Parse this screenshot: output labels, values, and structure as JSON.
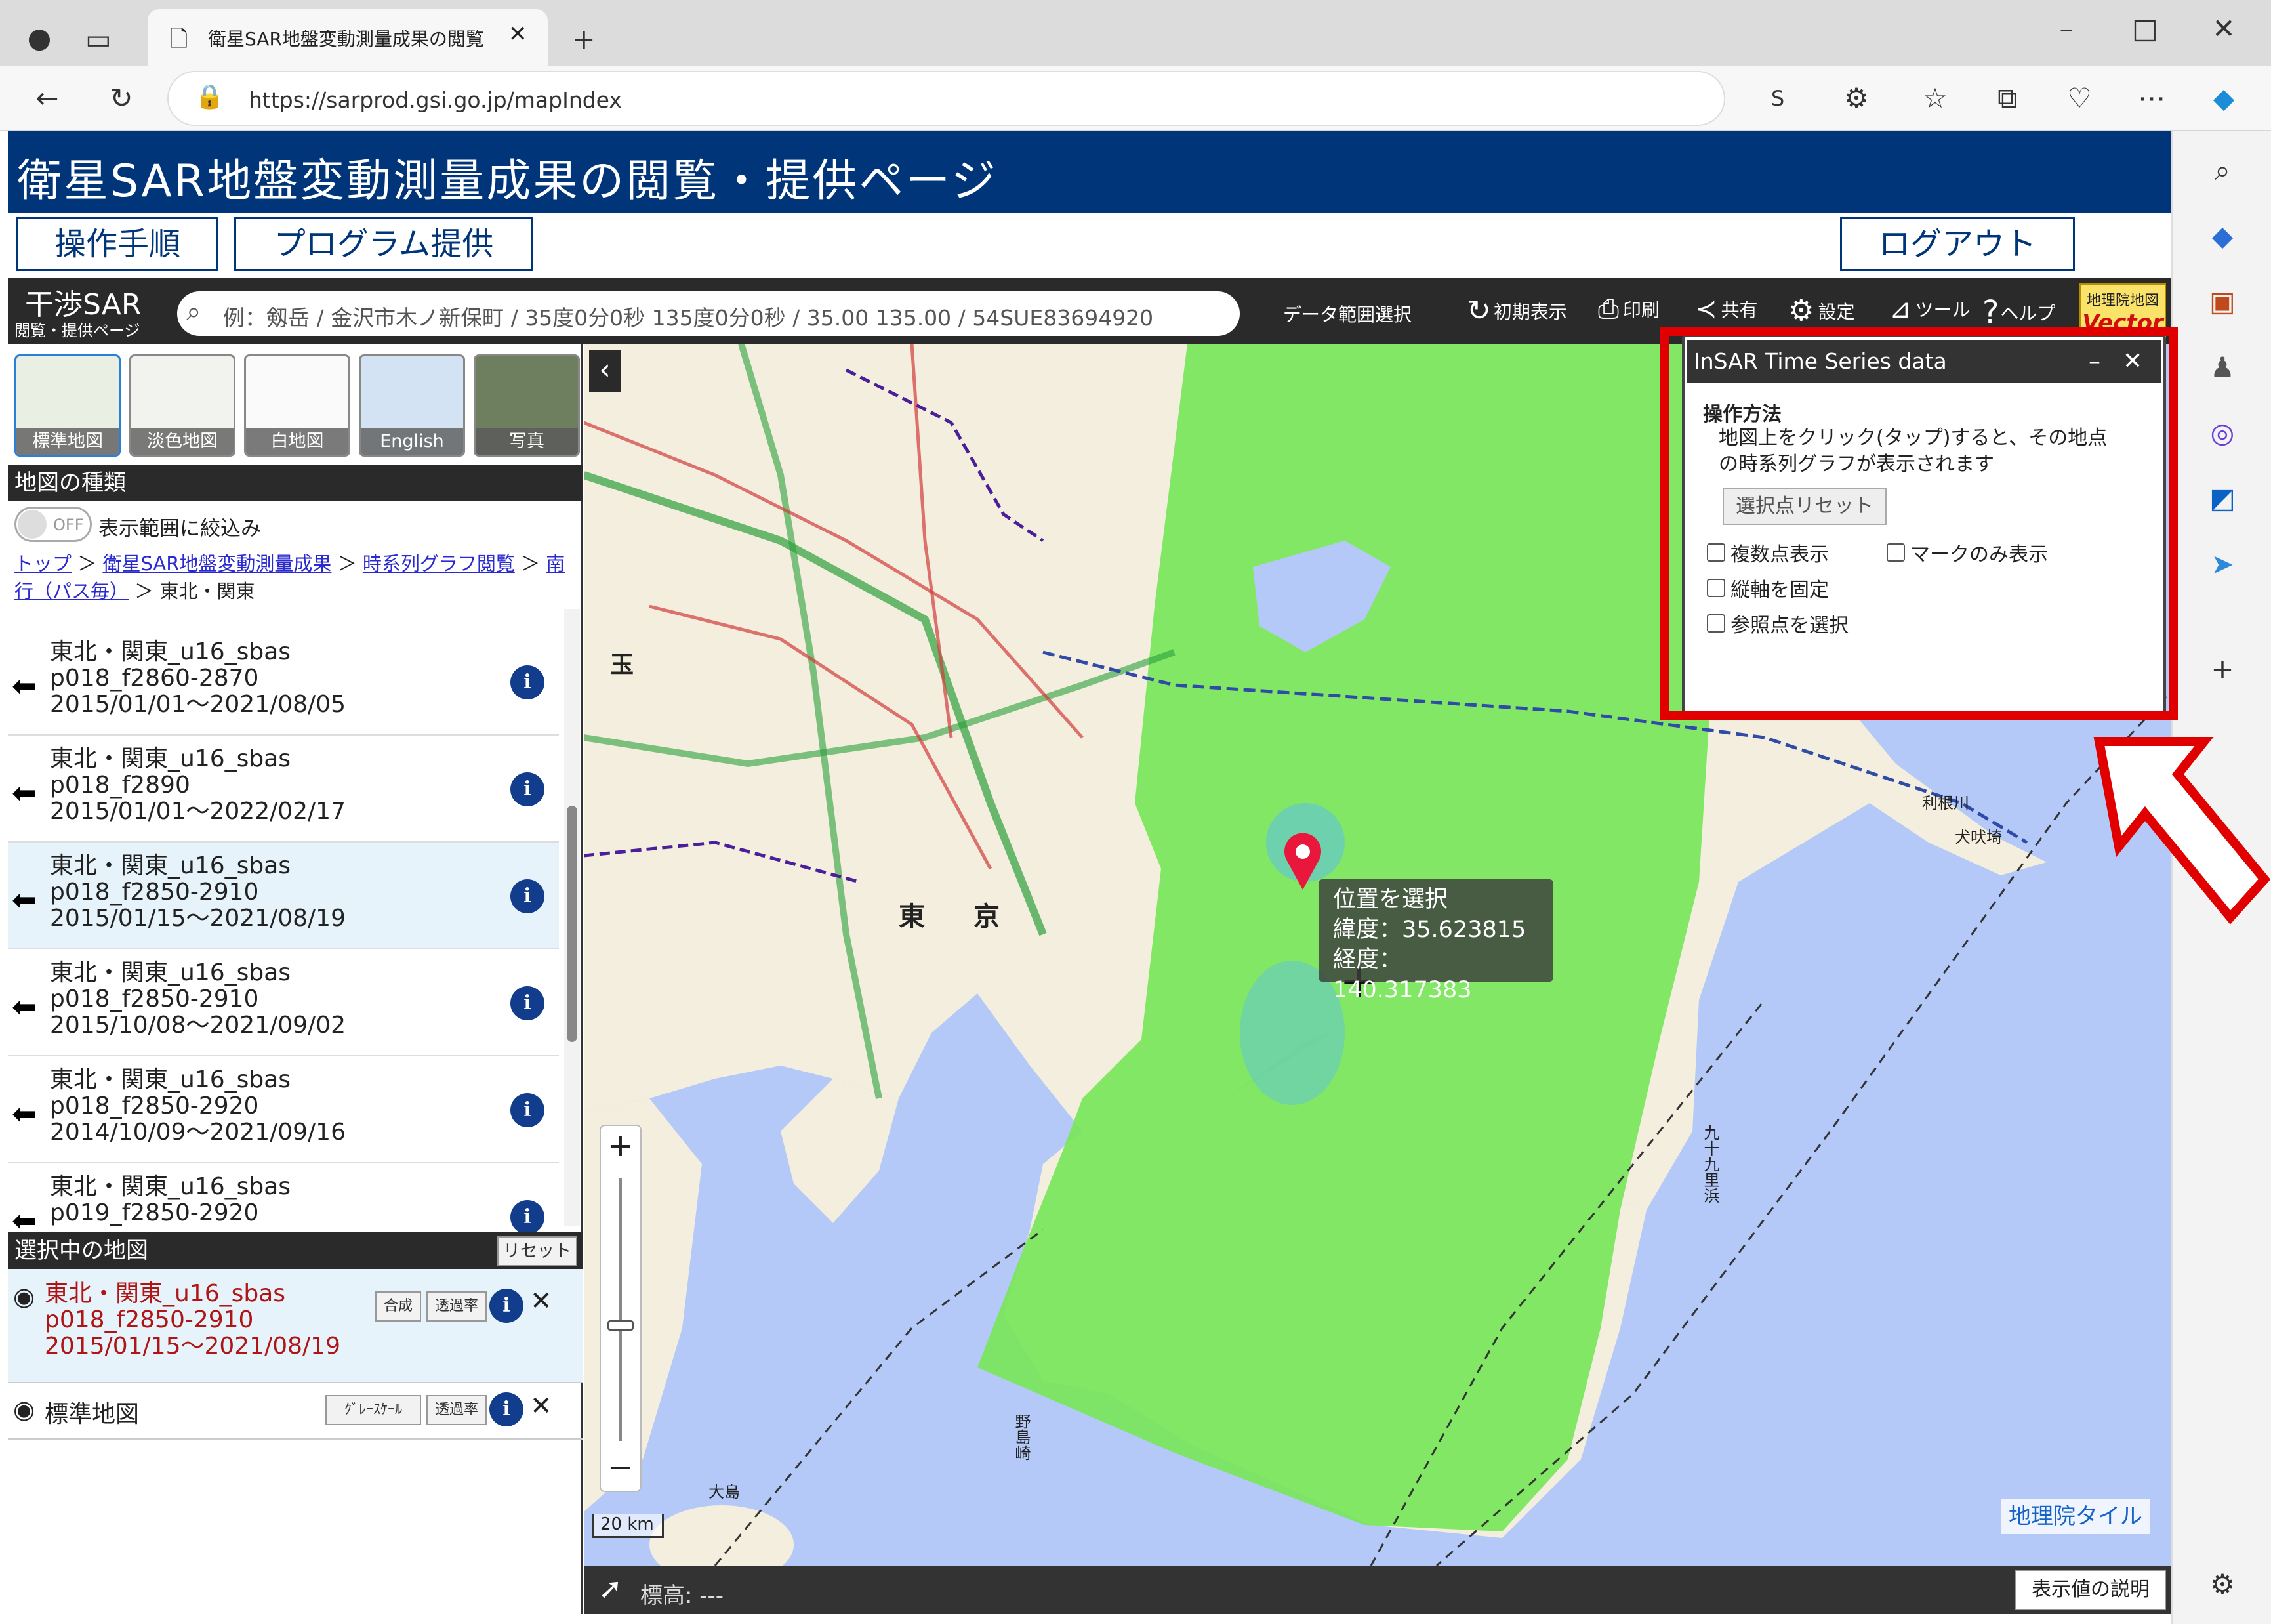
{
  "browser": {
    "tab_title": "衛星SAR地盤変動測量成果の閲覧",
    "url": "https://sarprod.gsi.go.jp/mapIndex"
  },
  "header": {
    "title": "衛星SAR地盤変動測量成果の閲覧・提供ページ",
    "btn_manual": "操作手順",
    "btn_program": "プログラム提供",
    "btn_logout": "ログアウト"
  },
  "toolbar": {
    "logo_main": "干渉SAR",
    "logo_sub": "閲覧・提供ページ",
    "search_placeholder": "例：剱岳 / 金沢市木ノ新保町 / 35度0分0秒 135度0分0秒 / 35.00 135.00 / 54SUE83694920",
    "data_range": "データ範囲選択",
    "initial": "初期表示",
    "print": "印刷",
    "share": "共有",
    "settings": "設定",
    "tools": "ツール",
    "help": "ヘルプ",
    "vector_top": "地理院地図",
    "vector_bottom": "Vector"
  },
  "basemaps": [
    {
      "label": "標準地図"
    },
    {
      "label": "淡色地図"
    },
    {
      "label": "白地図"
    },
    {
      "label": "English"
    },
    {
      "label": "写真"
    }
  ],
  "map_types": {
    "header": "地図の種類",
    "toggle": "OFF",
    "toggle_label": "表示範囲に絞込み",
    "breadcrumb": [
      "トップ",
      "衛星SAR地盤変動測量成果",
      "時系列グラフ閲覧",
      "南行（パス毎）"
    ],
    "breadcrumb_current": "東北・関東",
    "items": [
      {
        "l1": "東北・関東_u16_sbas",
        "l2": "p018_f2860-2870",
        "l3": "2015/01/01～2021/08/05"
      },
      {
        "l1": "東北・関東_u16_sbas",
        "l2": "p018_f2890",
        "l3": "2015/01/01～2022/02/17"
      },
      {
        "l1": "東北・関東_u16_sbas",
        "l2": "p018_f2850-2910",
        "l3": "2015/01/15～2021/08/19"
      },
      {
        "l1": "東北・関東_u16_sbas",
        "l2": "p018_f2850-2910",
        "l3": "2015/10/08～2021/09/02"
      },
      {
        "l1": "東北・関東_u16_sbas",
        "l2": "p018_f2850-2920",
        "l3": "2014/10/09～2021/09/16"
      },
      {
        "l1": "東北・関東_u16_sbas",
        "l2": "p019_f2850-2920",
        "l3": ""
      }
    ]
  },
  "selected": {
    "header": "選択中の地図",
    "reset": "リセット",
    "layer1": {
      "l1": "東北・関東_u16_sbas",
      "l2": "p018_f2850-2910",
      "l3": "2015/01/15～2021/08/19",
      "btn_combine": "合成",
      "btn_opacity": "透過率"
    },
    "layer2": {
      "name": "標準地図",
      "btn_gray": "ｸﾞﾚｰｽｹｰﾙ",
      "btn_opacity": "透過率"
    }
  },
  "insar_panel": {
    "title": "InSAR Time Series data",
    "howto": "操作方法",
    "desc1": "地図上をクリック(タップ)すると、その地点",
    "desc2": "の時系列グラフが表示されます",
    "reset_btn": "選択点リセット",
    "cb_multi": "複数点表示",
    "cb_mark": "マークのみ表示",
    "cb_fix": "縦軸を固定",
    "cb_ref": "参照点を選択"
  },
  "tooltip": {
    "title": "位置を選択",
    "lat_label": "緯度：",
    "lat": "35.623815",
    "lon_label": "経度：",
    "lon": "140.317383"
  },
  "map": {
    "scale": "20 km",
    "tile_credit": "地理院タイル",
    "elevation": "標高: ---",
    "legend_btn": "表示値の説明",
    "labels": {
      "tokyo1": "東",
      "tokyo2": "京",
      "ibaraki": "玉",
      "tone": "利根川",
      "inubo": "犬吠埼",
      "kujukuri": "九十九里浜",
      "oshima": "大島",
      "nojima": "野島崎"
    }
  },
  "colors": {
    "header": "#00357a",
    "insar": "#78e65a",
    "sea": "#b4c9f8",
    "land": "#f5f0e1",
    "pin": "#e8173b",
    "highlight": "#e00000"
  }
}
